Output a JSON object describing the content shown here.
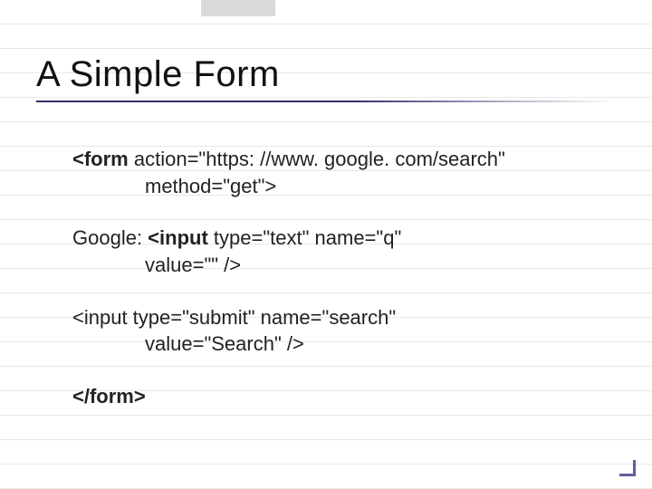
{
  "title": "A Simple Form",
  "code": {
    "line1a": "<form",
    "line1b": " action=\"https: //www. google. com/search\"",
    "line2": "method=\"get\">",
    "line3a": "Google: ",
    "line3b": "<input",
    "line3c": " type=\"text\" name=\"q\"",
    "line4": "value=\"\" />",
    "line5": "<input type=\"submit\" name=\"search\"",
    "line6": "value=\"Search\" />",
    "line7": "</form>"
  }
}
